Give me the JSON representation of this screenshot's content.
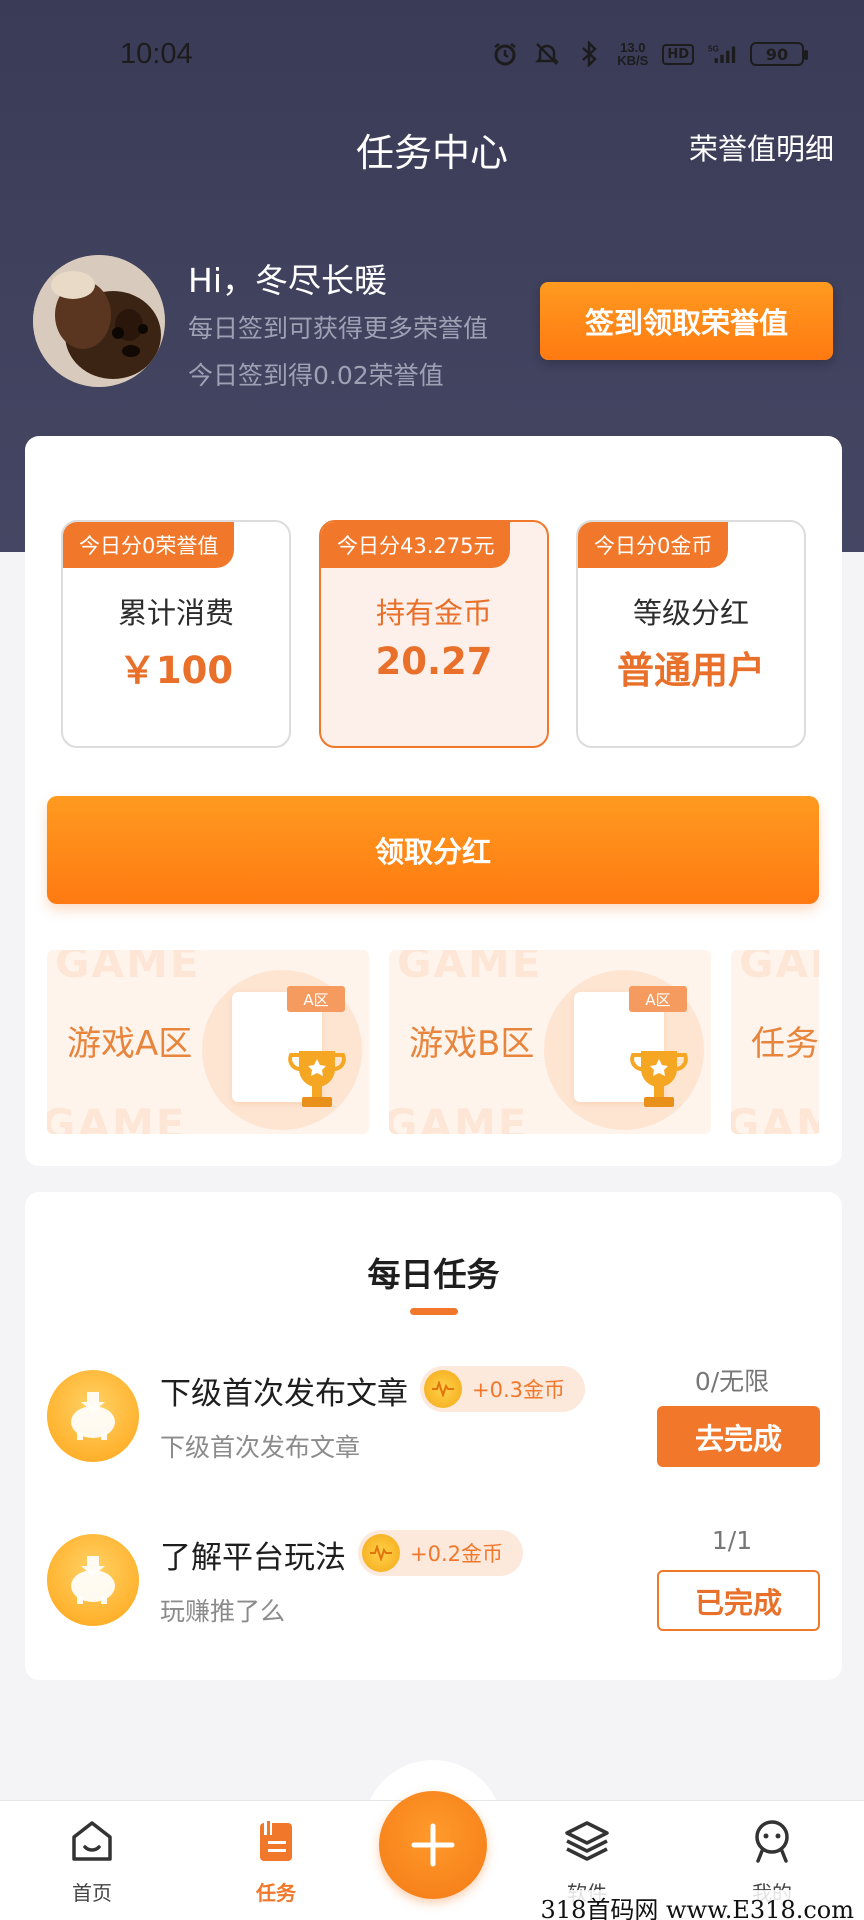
{
  "status_bar": {
    "time": "10:04",
    "net_speed_top": "13.0",
    "net_speed_bottom": "KB/S",
    "hd": "HD",
    "network": "5G",
    "battery": "90"
  },
  "header": {
    "title": "任务中心",
    "honor_detail_link": "荣誉值明细"
  },
  "user": {
    "greeting": "Hi，冬尽长暖",
    "subtitle1": "每日签到可获得更多荣誉值",
    "subtitle2": "今日签到得0.02荣誉值",
    "signin_button": "签到领取荣誉值"
  },
  "stats": [
    {
      "tag": "今日分0荣誉值",
      "label": "累计消费",
      "value": "￥100"
    },
    {
      "tag": "今日分43.275元",
      "label": "持有金币",
      "value": "20.27"
    },
    {
      "tag": "今日分0金币",
      "label": "等级分红",
      "value": "普通用户"
    }
  ],
  "dividend_button": "领取分红",
  "zones": [
    {
      "label": "游戏A区",
      "badge": "A区",
      "bg_text": "GAME"
    },
    {
      "label": "游戏B区",
      "badge": "A区",
      "bg_text": "GAME"
    },
    {
      "label": "任务",
      "badge": "",
      "bg_text": "GAM"
    }
  ],
  "daily": {
    "title": "每日任务",
    "tasks": [
      {
        "title": "下级首次发布文章",
        "reward": "+0.3金币",
        "desc": "下级首次发布文章",
        "progress": "0/无限",
        "button": "去完成",
        "state": "go"
      },
      {
        "title": "了解平台玩法",
        "reward": "+0.2金币",
        "desc": "玩赚推了么",
        "progress": "1/1",
        "button": "已完成",
        "state": "done"
      }
    ]
  },
  "nav": {
    "home": "首页",
    "tasks": "任务",
    "software": "软件",
    "mine": "我的"
  },
  "colors": {
    "accent": "#f1782a",
    "header_bg": "#3a3c57"
  },
  "watermark": "318首码网 www.E318.com"
}
